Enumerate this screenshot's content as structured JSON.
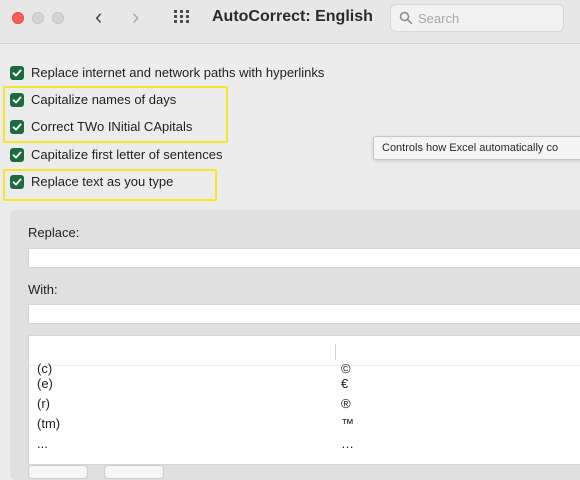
{
  "window": {
    "title": "AutoCorrect: English"
  },
  "search": {
    "placeholder": "Search"
  },
  "options": [
    {
      "label": "Replace internet and network paths with hyperlinks",
      "checked": true
    },
    {
      "label": "Capitalize names of days",
      "checked": true
    },
    {
      "label": "Correct TWo INitial CApitals",
      "checked": true
    },
    {
      "label": "Capitalize first letter of sentences",
      "checked": true
    },
    {
      "label": "Replace text as you type",
      "checked": true
    }
  ],
  "tooltip": {
    "text": "Controls how Excel automatically co"
  },
  "replace": {
    "label": "Replace:",
    "value": ""
  },
  "with": {
    "label": "With:",
    "value": ""
  },
  "entries": [
    {
      "replace": "(c)",
      "with": "©"
    },
    {
      "replace": "(e)",
      "with": "€"
    },
    {
      "replace": "(r)",
      "with": "®"
    },
    {
      "replace": "(tm)",
      "with": "™"
    },
    {
      "replace": "...",
      "with": "…"
    }
  ],
  "colors": {
    "checkbox": "#1c6a40",
    "highlight": "#f6e52a",
    "close": "#fd5f57"
  }
}
